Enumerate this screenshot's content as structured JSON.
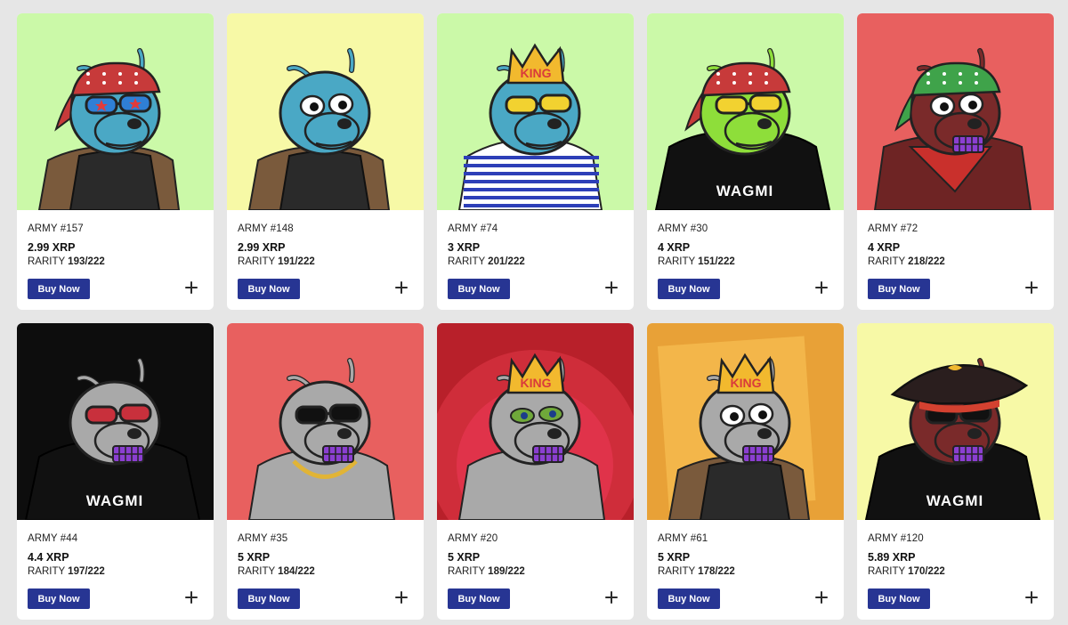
{
  "listing": {
    "buy_label": "Buy Now",
    "cards": [
      {
        "name": "ARMY #157",
        "price": "2.99 XRP",
        "rarity_label": "RARITY",
        "rarity": "193/222",
        "bg": "#cbf9a8",
        "skin": "#4aa8c5",
        "outfit": "black-vest",
        "headwear": "bandana-red",
        "eyes": "star-shades",
        "shirt_text": ""
      },
      {
        "name": "ARMY #148",
        "price": "2.99 XRP",
        "rarity_label": "RARITY",
        "rarity": "191/222",
        "bg": "#f7f9a6",
        "skin": "#4aa8c5",
        "outfit": "aviator-jacket",
        "headwear": "none",
        "eyes": "wide",
        "shirt_text": ""
      },
      {
        "name": "ARMY #74",
        "price": "3 XRP",
        "rarity_label": "RARITY",
        "rarity": "201/222",
        "bg": "#cbf9a8",
        "skin": "#4aa8c5",
        "outfit": "striped-shirt",
        "headwear": "crown",
        "eyes": "yellow-shades",
        "shirt_text": "",
        "crown_text": "KING"
      },
      {
        "name": "ARMY #30",
        "price": "4 XRP",
        "rarity_label": "RARITY",
        "rarity": "151/222",
        "bg": "#cbf9a8",
        "skin": "#8ede3a",
        "outfit": "black-tee",
        "headwear": "bandana-red",
        "eyes": "yellow-shades",
        "shirt_text": "WAGMI"
      },
      {
        "name": "ARMY #72",
        "price": "4 XRP",
        "rarity_label": "RARITY",
        "rarity": "218/222",
        "bg": "#e8605f",
        "skin": "#7a2a2a",
        "outfit": "red-scarf",
        "headwear": "bandana-green",
        "eyes": "wide",
        "shirt_text": ""
      },
      {
        "name": "ARMY #44",
        "price": "4.4 XRP",
        "rarity_label": "RARITY",
        "rarity": "197/222",
        "bg": "#0d0d0d",
        "skin": "#a9a9a9",
        "outfit": "black-tee",
        "headwear": "none",
        "eyes": "red-hearts",
        "shirt_text": "WAGMI"
      },
      {
        "name": "ARMY #35",
        "price": "5 XRP",
        "rarity_label": "RARITY",
        "rarity": "184/222",
        "bg": "#e8605f",
        "skin": "#a9a9a9",
        "outfit": "gold-chain",
        "headwear": "none",
        "eyes": "xrp-shades",
        "shirt_text": ""
      },
      {
        "name": "ARMY #20",
        "price": "5 XRP",
        "rarity_label": "RARITY",
        "rarity": "189/222",
        "bg": "#b8202a",
        "skin": "#a9a9a9",
        "outfit": "bare",
        "headwear": "crown",
        "eyes": "green-pepe",
        "shirt_text": "",
        "crown_text": "KING"
      },
      {
        "name": "ARMY #61",
        "price": "5 XRP",
        "rarity_label": "RARITY",
        "rarity": "178/222",
        "bg": "#e8a137",
        "skin": "#a9a9a9",
        "outfit": "black-vest",
        "headwear": "crown",
        "eyes": "wide",
        "shirt_text": "",
        "crown_text": "KING"
      },
      {
        "name": "ARMY #120",
        "price": "5.89 XRP",
        "rarity_label": "RARITY",
        "rarity": "170/222",
        "bg": "#f7f9a6",
        "skin": "#7a2a2a",
        "outfit": "black-tee",
        "headwear": "pirate-hat",
        "eyes": "xrp-shades",
        "shirt_text": "WAGMI"
      }
    ]
  },
  "colors": {
    "button": "#273593",
    "page_bg": "#e6e6e6",
    "card_bg": "#ffffff"
  }
}
